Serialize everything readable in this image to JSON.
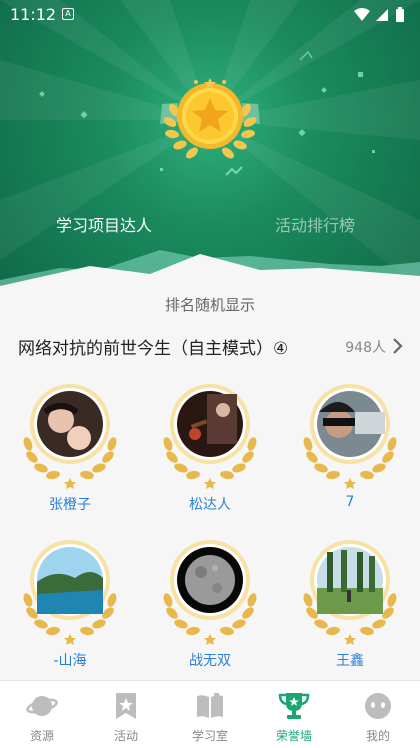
{
  "status_bar": {
    "time": "11:12",
    "notification_icon": "A"
  },
  "hero": {
    "tabs": [
      {
        "label": "学习项目达人",
        "active": true
      },
      {
        "label": "活动排行榜",
        "active": false
      }
    ],
    "medal_icon": "star-medal-icon"
  },
  "content": {
    "random_hint": "排名随机显示",
    "project": {
      "name": "网络对抗的前世今生（自主模式）④",
      "count": "948人"
    },
    "members": [
      {
        "name": "张橙子",
        "avatar": "two-children-photo"
      },
      {
        "name": "松达人",
        "avatar": "guitar-girl-photo"
      },
      {
        "name": "7",
        "avatar": "car-selfie-photo"
      },
      {
        "name": "-山海",
        "avatar": "coastline-photo"
      },
      {
        "name": "战无双",
        "avatar": "moon-photo"
      },
      {
        "name": "王鑫",
        "avatar": "tree-road-photo"
      }
    ]
  },
  "tabbar": {
    "items": [
      {
        "label": "资源",
        "icon": "planet-icon",
        "active": false
      },
      {
        "label": "活动",
        "icon": "bookmark-star-icon",
        "active": false
      },
      {
        "label": "学习室",
        "icon": "book-icon",
        "active": false
      },
      {
        "label": "荣誉墙",
        "icon": "trophy-icon",
        "active": true
      },
      {
        "label": "我的",
        "icon": "face-icon",
        "active": false
      }
    ]
  },
  "colors": {
    "accent": "#19a672",
    "hero_dark": "#0f6a47",
    "gold": "#e8b84a",
    "name_blue": "#2a7fd4"
  }
}
